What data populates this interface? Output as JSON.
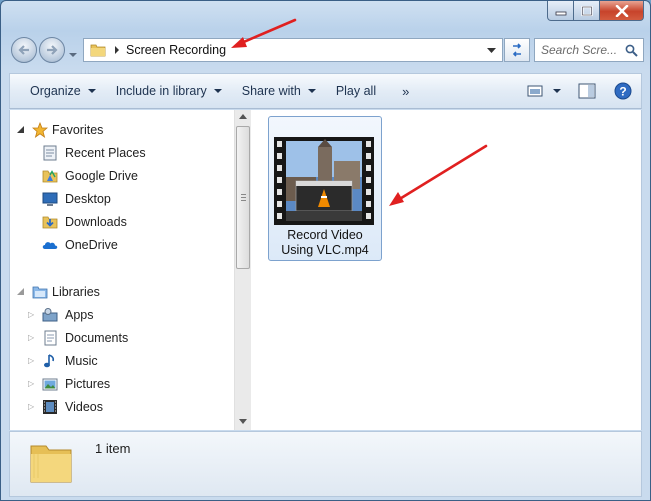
{
  "window": {
    "caption_buttons": [
      "minimize",
      "maximize",
      "close"
    ]
  },
  "address": {
    "path_segment": "Screen Recording",
    "search_placeholder": "Search Scre..."
  },
  "toolbar": {
    "organize": "Organize",
    "include_in_library": "Include in library",
    "share_with": "Share with",
    "play_all": "Play all",
    "more": "»"
  },
  "nav": {
    "favorites": {
      "label": "Favorites",
      "items": [
        {
          "label": "Recent Places",
          "icon": "recent-places-icon"
        },
        {
          "label": "Google Drive",
          "icon": "google-drive-icon"
        },
        {
          "label": "Desktop",
          "icon": "desktop-icon"
        },
        {
          "label": "Downloads",
          "icon": "downloads-icon"
        },
        {
          "label": "OneDrive",
          "icon": "onedrive-icon"
        }
      ]
    },
    "libraries": {
      "label": "Libraries",
      "items": [
        {
          "label": "Apps",
          "icon": "apps-icon"
        },
        {
          "label": "Documents",
          "icon": "documents-icon"
        },
        {
          "label": "Music",
          "icon": "music-icon"
        },
        {
          "label": "Pictures",
          "icon": "pictures-icon"
        },
        {
          "label": "Videos",
          "icon": "videos-icon"
        }
      ]
    }
  },
  "files": [
    {
      "name_line1": "Record Video",
      "name_line2": "Using VLC.mp4",
      "icon": "video-file-icon"
    }
  ],
  "status": {
    "item_count": "1 item"
  },
  "colors": {
    "annotation_arrow": "#e02020",
    "selection_border": "#7da2ce",
    "window_frame": "#b9d1ea"
  }
}
